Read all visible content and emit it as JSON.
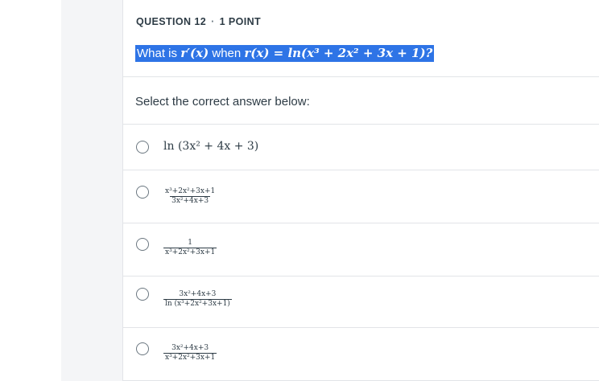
{
  "question": {
    "number_label": "QUESTION 12",
    "separator": "·",
    "points_label": "1 POINT",
    "text_plain": "What is",
    "text_fn": "r′(x)",
    "text_when": "when",
    "text_eq": "r(x) = ln(x³ + 2x² + 3x + 1)?",
    "highlight_color": "#2e74e6",
    "prompt": "Select the correct answer below:"
  },
  "options": [
    {
      "display": "ln (3x² + 4x + 3)"
    },
    {
      "numerator": "x³+2x²+3x+1",
      "denominator": "3x²+4x+3"
    },
    {
      "numerator": "1",
      "denominator": "x³+2x²+3x+1"
    },
    {
      "numerator": "3x²+4x+3",
      "denominator": "ln (x³+2x²+3x+1)"
    },
    {
      "numerator": "3x²+4x+3",
      "denominator": "x³+2x²+3x+1"
    }
  ]
}
